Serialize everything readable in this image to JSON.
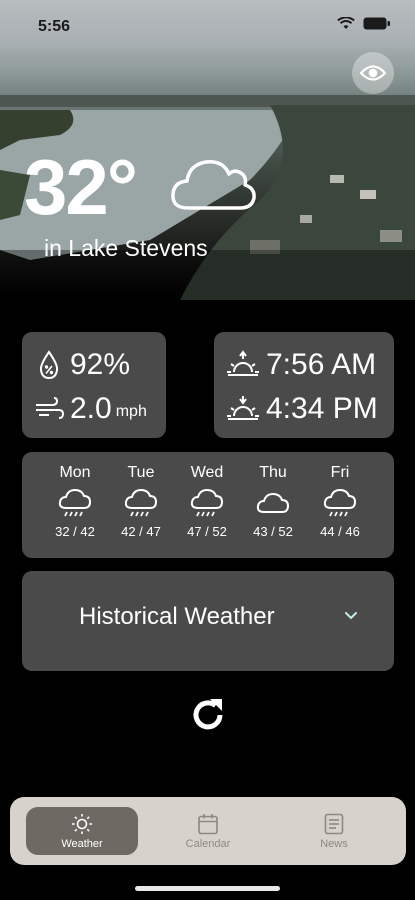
{
  "status": {
    "time": "5:56"
  },
  "current": {
    "temperature": "32°",
    "location": "in Lake Stevens",
    "humidity": "92%",
    "wind_speed": "2.0",
    "wind_unit": "mph",
    "sunrise": "7:56 AM",
    "sunset": "4:34 PM",
    "condition_icon": "cloud-icon"
  },
  "forecast": [
    {
      "day": "Mon",
      "range": "32 / 42",
      "icon": "rain-cloud-icon"
    },
    {
      "day": "Tue",
      "range": "42 / 47",
      "icon": "rain-cloud-icon"
    },
    {
      "day": "Wed",
      "range": "47 / 52",
      "icon": "rain-cloud-icon"
    },
    {
      "day": "Thu",
      "range": "43 / 52",
      "icon": "cloud-icon"
    },
    {
      "day": "Fri",
      "range": "44 / 46",
      "icon": "rain-cloud-icon"
    }
  ],
  "historical": {
    "label": "Historical Weather"
  },
  "tabs": [
    {
      "label": "Weather",
      "icon": "sun-icon",
      "active": true
    },
    {
      "label": "Calendar",
      "icon": "calendar-icon",
      "active": false
    },
    {
      "label": "News",
      "icon": "news-icon",
      "active": false
    }
  ],
  "colors": {
    "card": "#4a4a4a",
    "tabbar": "#d8d2cc",
    "tab_active": "#6f6963"
  }
}
